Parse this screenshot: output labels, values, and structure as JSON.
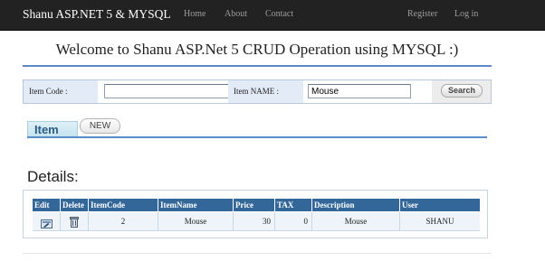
{
  "navbar": {
    "brand": "Shanu ASP.NET 5 & MYSQL",
    "links": [
      "Home",
      "About",
      "Contact"
    ],
    "register": "Register",
    "login": "Log in"
  },
  "header": {
    "welcome": "Welcome to Shanu ASP.Net 5 CRUD Operation using MYSQL :)"
  },
  "search": {
    "item_code_label": "Item Code :",
    "item_code_value": "",
    "item_name_label": "Item NAME :",
    "item_name_value": "Mouse",
    "button": "Search"
  },
  "tabs": {
    "item": "Item",
    "new": "NEW"
  },
  "details": {
    "title": "Details:",
    "columns": [
      "Edit",
      "Delete",
      "ItemCode",
      "ItemName",
      "Price",
      "TAX",
      "Description",
      "User"
    ],
    "rows": [
      {
        "item_code": "2",
        "item_name": "Mouse",
        "price": "30",
        "tax": "0",
        "description": "Mouse",
        "user": "SHANU"
      }
    ]
  },
  "icons": {
    "edit": "edit-icon",
    "delete": "trash-icon"
  },
  "colors": {
    "navbar_bg": "#222222",
    "header_blue": "#336699",
    "divider_blue": "#5b8ac9"
  }
}
